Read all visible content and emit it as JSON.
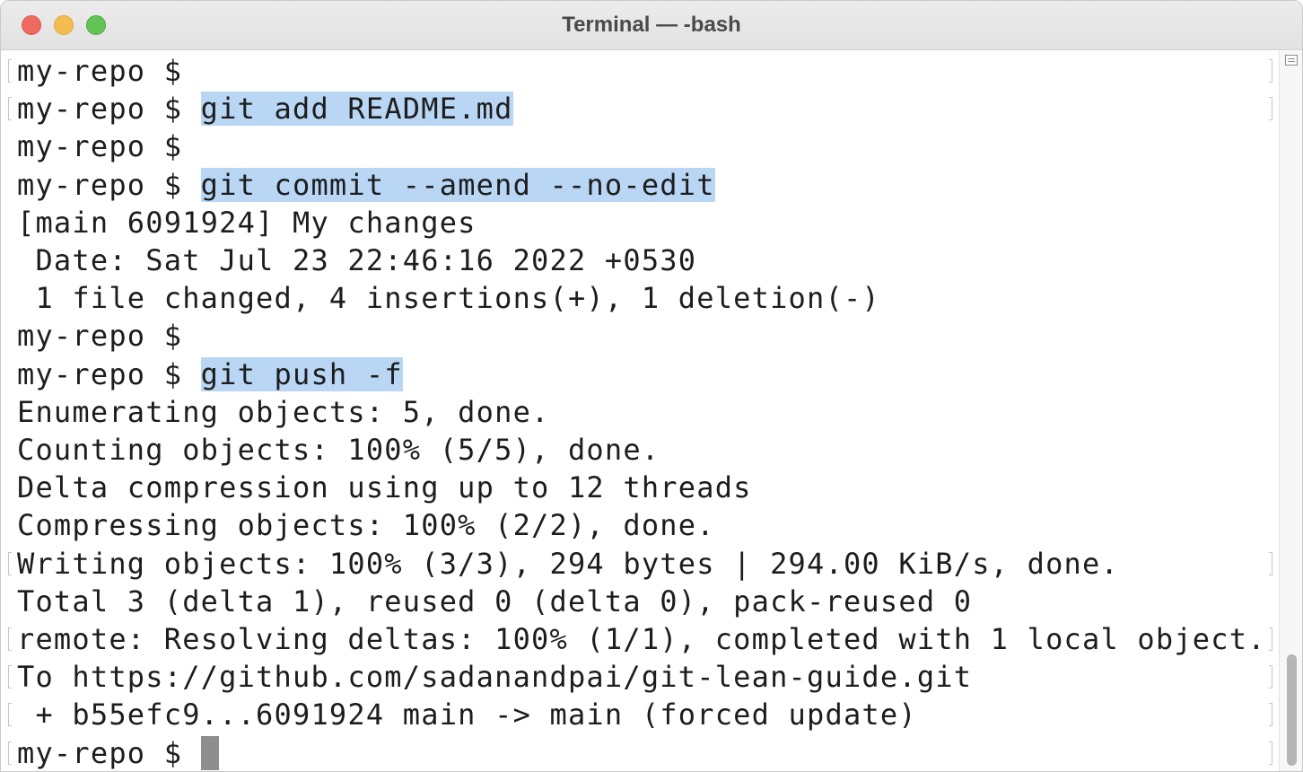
{
  "window": {
    "title": "Terminal — -bash",
    "buttons": [
      "close",
      "minimize",
      "zoom"
    ]
  },
  "terminal": {
    "lines": [
      {
        "prompt": "my-repo $",
        "command": ""
      },
      {
        "prompt": "my-repo $",
        "command": "git add README.md"
      },
      {
        "prompt": "my-repo $",
        "command": ""
      },
      {
        "prompt": "my-repo $",
        "command": "git commit --amend --no-edit"
      },
      {
        "output": "[main 6091924] My changes"
      },
      {
        "output": " Date: Sat Jul 23 22:46:16 2022 +0530"
      },
      {
        "output": " 1 file changed, 4 insertions(+), 1 deletion(-)"
      },
      {
        "prompt": "my-repo $",
        "command": ""
      },
      {
        "prompt": "my-repo $",
        "command": "git push -f"
      },
      {
        "output": "Enumerating objects: 5, done."
      },
      {
        "output": "Counting objects: 100% (5/5), done."
      },
      {
        "output": "Delta compression using up to 12 threads"
      },
      {
        "output": "Compressing objects: 100% (2/2), done."
      },
      {
        "output": "Writing objects: 100% (3/3), 294 bytes | 294.00 KiB/s, done."
      },
      {
        "output": "Total 3 (delta 1), reused 0 (delta 0), pack-reused 0"
      },
      {
        "output": "remote: Resolving deltas: 100% (1/1), completed with 1 local object."
      },
      {
        "output": "To https://github.com/sadanandpai/git-lean-guide.git"
      },
      {
        "output": " + b55efc9...6091924 main -> main (forced update)"
      },
      {
        "prompt": "my-repo $",
        "command": "",
        "cursor": true
      }
    ]
  },
  "icons": {
    "scrollbar_grip": "scroll-menu-icon"
  },
  "colors": {
    "selection_highlight": "#b9d6f5",
    "close": "#ee6a5f",
    "minimize": "#f5bd4f",
    "zoom": "#61c454",
    "cursor": "#8e8e8e"
  }
}
